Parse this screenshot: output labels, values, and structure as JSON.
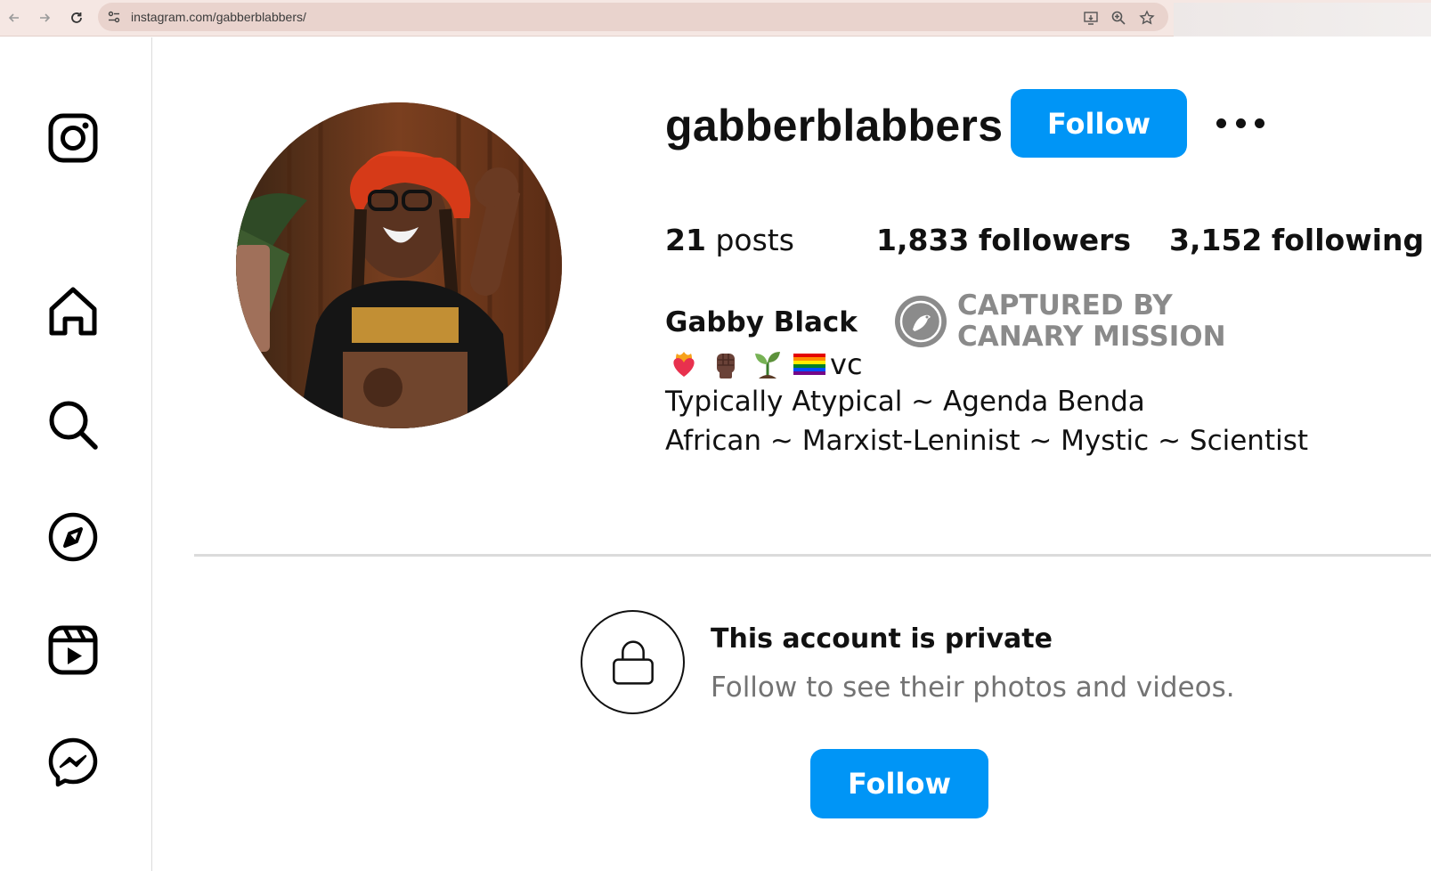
{
  "browser": {
    "url": "instagram.com/gabberblabbers/",
    "back_icon": "arrow-left-icon",
    "forward_icon": "arrow-right-icon",
    "reload_icon": "reload-icon"
  },
  "sidebar": {
    "items": [
      {
        "name": "instagram-logo",
        "icon": "instagram-icon"
      },
      {
        "name": "home",
        "icon": "home-icon"
      },
      {
        "name": "search",
        "icon": "search-icon"
      },
      {
        "name": "explore",
        "icon": "compass-icon"
      },
      {
        "name": "reels",
        "icon": "reels-icon"
      },
      {
        "name": "messages",
        "icon": "messenger-icon"
      }
    ]
  },
  "profile": {
    "username": "gabberblabbers",
    "follow_label": "Follow",
    "posts_count": "21",
    "posts_label": "posts",
    "followers_count": "1,833",
    "followers_label": "followers",
    "following_count": "3,152",
    "following_label": "following",
    "full_name": "Gabby Black",
    "emoji_suffix": "vc",
    "bio_line1": "Typically Atypical ~ Agenda Benda",
    "bio_line2": "African ~ Marxist-Leninist ~ Mystic ~ Scientist"
  },
  "watermark": {
    "line1": "CAPTURED BY",
    "line2": "CANARY MISSION"
  },
  "private": {
    "title": "This account is private",
    "subtitle": "Follow to see their photos and videos.",
    "follow_label": "Follow"
  },
  "colors": {
    "accent": "#0095f6",
    "muted_text": "#737373",
    "chrome_bg": "#f5e7e3"
  }
}
